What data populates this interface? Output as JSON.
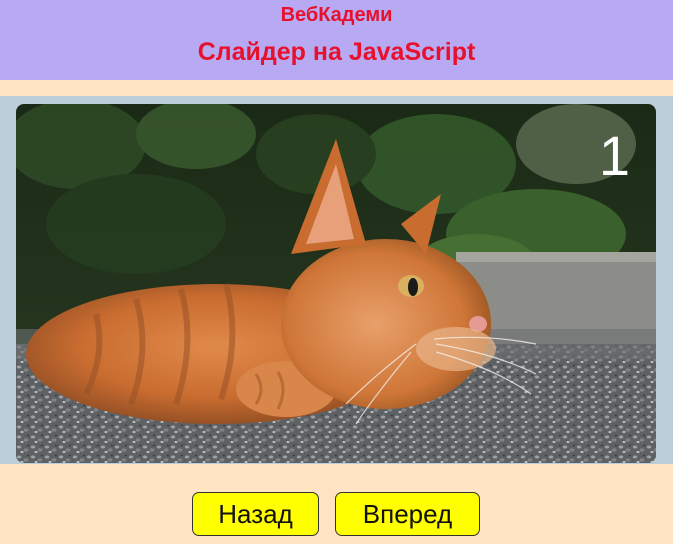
{
  "header": {
    "brand": "ВебКадеми",
    "title": "Слайдер на JavaScript",
    "colors": {
      "background": "#B7A9F2",
      "text": "#E8112D"
    }
  },
  "slider": {
    "current_slide": "1",
    "image_description": "ginger cat lying on gravel ground",
    "frame_color": "#BDCEDB",
    "page_background": "#FFE4C4"
  },
  "controls": {
    "prev_label": "Назад",
    "next_label": "Вперед",
    "button_color": "#FFFF00"
  }
}
